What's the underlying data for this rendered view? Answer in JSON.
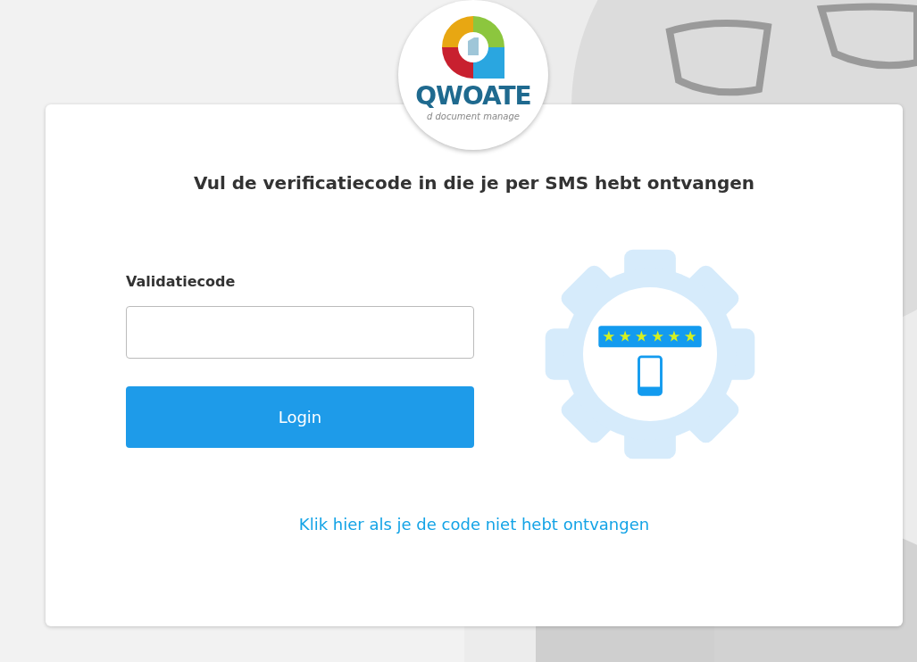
{
  "logo": {
    "wordmark": "QWOATE",
    "tagline": "d document manage"
  },
  "title": "Vul de verificatiecode in die je per SMS hebt ontvangen",
  "field": {
    "label": "Validatiecode"
  },
  "button": "Login",
  "link": "Klik hier als je de code niet hebt ontvangen"
}
